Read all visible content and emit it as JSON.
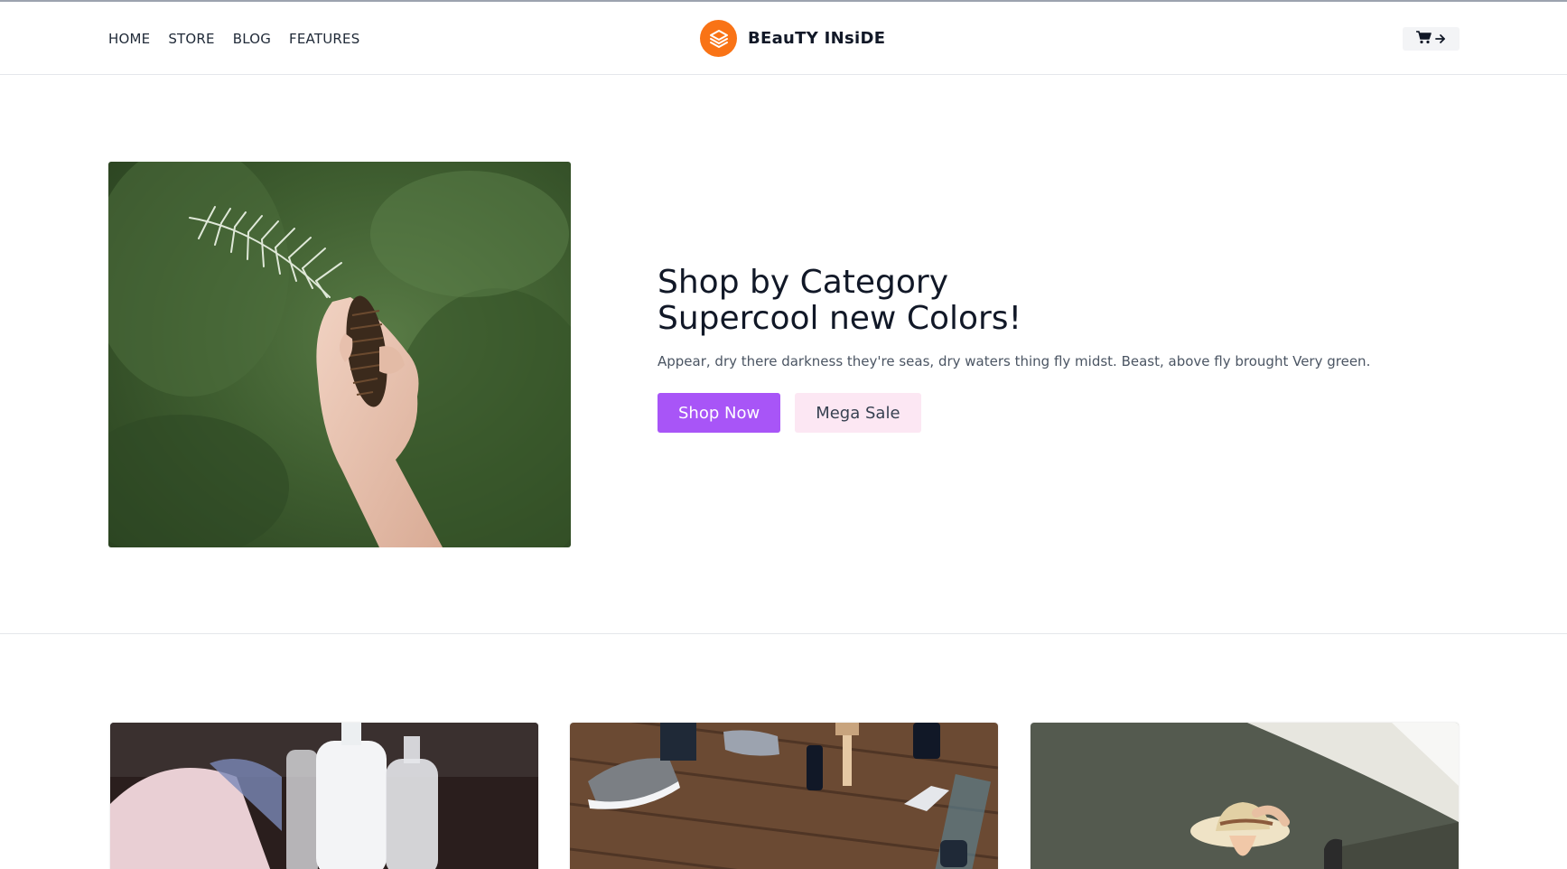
{
  "header": {
    "nav": [
      "HOME",
      "STORE",
      "BLOG",
      "FEATURES"
    ],
    "brand_name": "BEauTY INsiDE",
    "brand_icon": "layers-icon",
    "cart_icon": "cart-icon",
    "cart_arrow_icon": "arrow-right-icon"
  },
  "hero": {
    "title_line1": "Shop by Category",
    "title_line2": "Supercool new Colors!",
    "description": "Appear, dry there darkness they're seas, dry waters thing fly midst. Beast, above fly brought Very green.",
    "primary_button": "Shop Now",
    "secondary_button": "Mega Sale",
    "image": "hand-holding-pinecone-and-fern"
  },
  "cards": [
    {
      "image": "cosmetic-bottles-and-mask"
    },
    {
      "image": "sneakers-and-paint-brushes-on-wood-floor"
    },
    {
      "image": "woman-in-straw-hat"
    }
  ],
  "colors": {
    "accent_primary": "#a855f7",
    "accent_secondary": "#fce7f3",
    "brand": "#f97316"
  }
}
